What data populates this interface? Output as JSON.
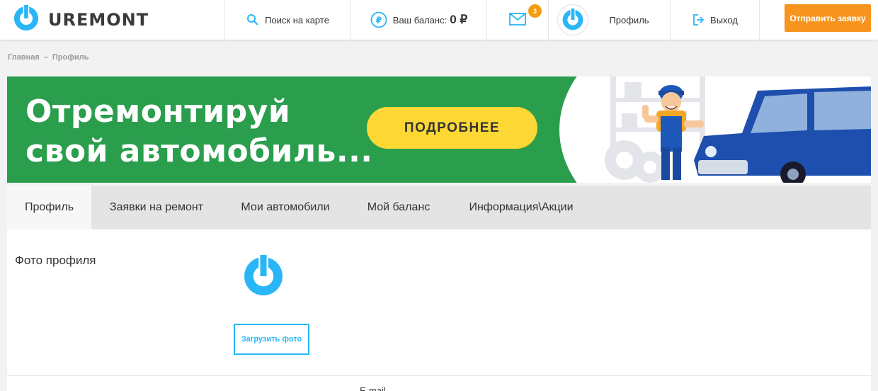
{
  "header": {
    "logo_text": "UREMONT",
    "map_search": "Поиск на карте",
    "balance_label": "Ваш баланс:",
    "balance_value": "0 ₽",
    "messages_count": "3",
    "profile": "Профиль",
    "logout": "Выход",
    "send_request": "Отправить заявку"
  },
  "breadcrumb": {
    "home": "Главная",
    "separator": "–",
    "current": "Профиль"
  },
  "banner": {
    "title_line1": "Отремонтируй",
    "title_line2": "свой автомобиль...",
    "button": "ПОДРОБНЕЕ"
  },
  "tabs": [
    {
      "label": "Профиль"
    },
    {
      "label": "Заявки на ремонт"
    },
    {
      "label": "Мои автомобили"
    },
    {
      "label": "Мой баланс"
    },
    {
      "label": "Информация\\Акции"
    }
  ],
  "profile": {
    "photo_label": "Фото профиля",
    "upload_button": "Загрузить фото",
    "next_row_partial": "E-mail"
  },
  "colors": {
    "brand_blue": "#29b6f6",
    "accent_orange": "#f7941d",
    "banner_green": "#2a9e4d",
    "banner_button": "#fdd835"
  }
}
